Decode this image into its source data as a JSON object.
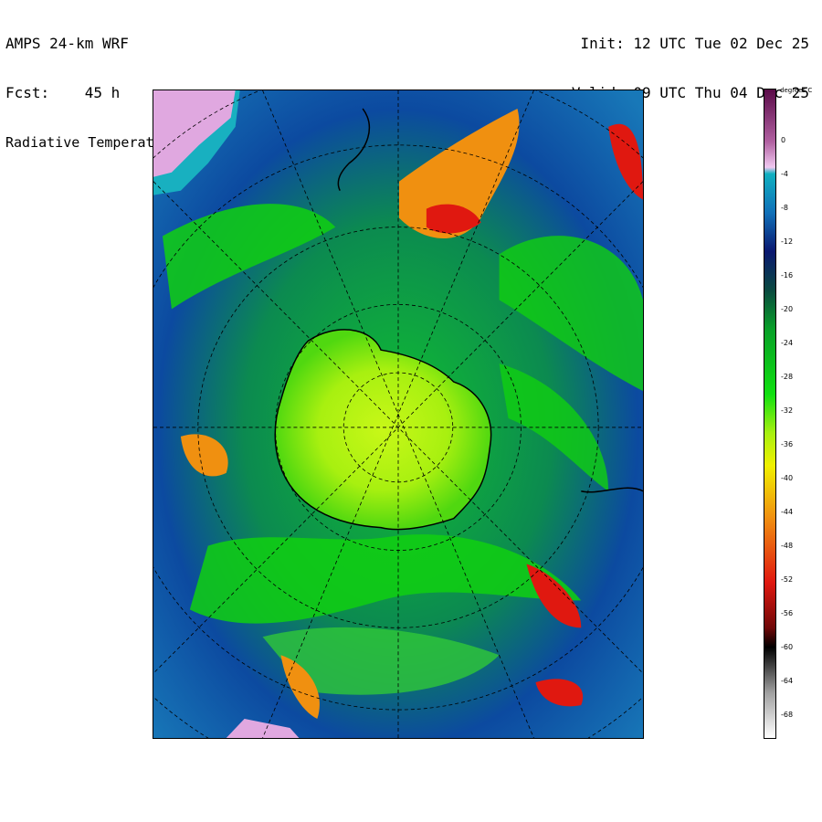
{
  "header": {
    "model": "AMPS 24-km WRF",
    "forecast": "Fcst:    45 h",
    "field": "Radiative Temperature",
    "init": "Init: 12 UTC Tue 02 Dec 25",
    "valid": "Valid: 09 UTC Thu 04 Dec 25"
  },
  "colorbar": {
    "unit": "degrees C",
    "labels": [
      "0",
      "-4",
      "-8",
      "-12",
      "-16",
      "-20",
      "-24",
      "-28",
      "-32",
      "-36",
      "-40",
      "-44",
      "-48",
      "-52",
      "-56",
      "-60",
      "-64",
      "-68"
    ],
    "colors": {
      "magenta": "#8a1a6e",
      "pink": "#e8a8e0",
      "cyan": "#16b8c8",
      "blue": "#1848a8",
      "navy": "#0a1870",
      "green": "#10d010",
      "lime": "#a8f010",
      "yellow": "#f0f000",
      "orange": "#f09010",
      "red": "#e01810",
      "darkred": "#700808",
      "black": "#000000",
      "gray": "#a0a0a0",
      "white": "#ffffff"
    }
  },
  "map": {
    "type": "polar-stereographic",
    "hemisphere": "south",
    "field_colors": {
      "ocean": "#0e4a9a",
      "cloud_cold": "#10d010",
      "plateau": "#a8f010",
      "deep_cloud": "#e01810",
      "warm_land": "#e0a8e0",
      "shallow": "#18b0c0",
      "coast": "#000000",
      "grid": "#000000"
    }
  }
}
